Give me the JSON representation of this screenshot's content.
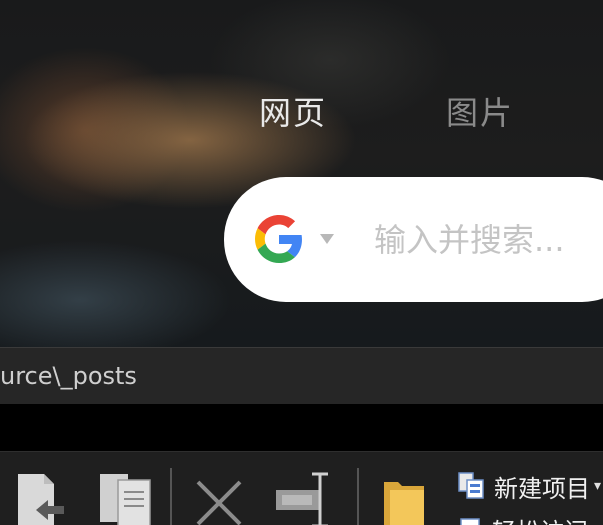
{
  "search_tabs": {
    "web": "网页",
    "images": "图片"
  },
  "search": {
    "placeholder": "输入并搜索...",
    "engine_icon": "google-g-icon"
  },
  "pathbar": {
    "path": "urce\\_posts"
  },
  "ribbon": {
    "new_item_label": "新建项目",
    "easy_access_label": "轻松访问",
    "icons": [
      "copy-path-icon",
      "copy-icon",
      "delete-icon",
      "rename-icon",
      "new-folder-icon",
      "new-item-icon",
      "easy-access-icon"
    ]
  },
  "colors": {
    "google_blue": "#4285F4",
    "google_red": "#EA4335",
    "google_yellow": "#FBBC05",
    "google_green": "#34A853",
    "folder_yellow": "#f3c75a"
  }
}
